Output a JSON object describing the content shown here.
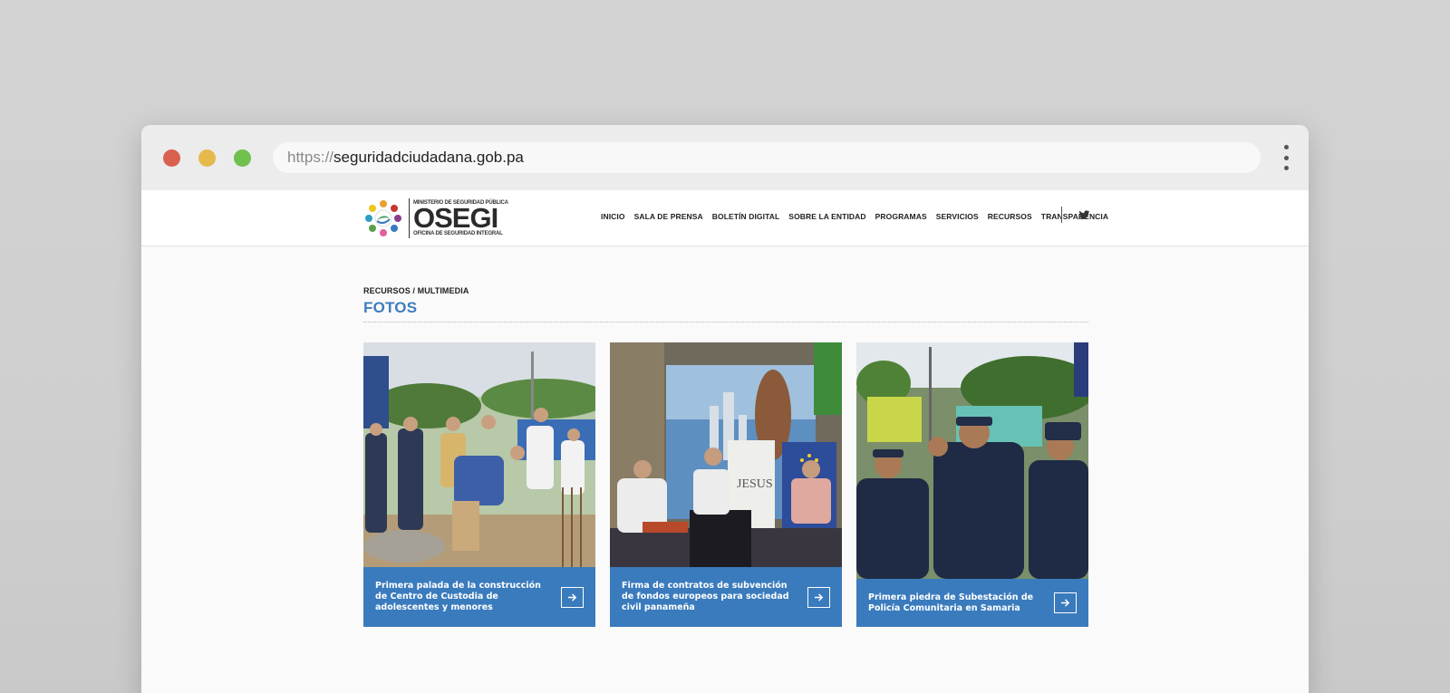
{
  "browser": {
    "url_protocol": "https://",
    "url_host": "seguridadciudadana.gob.pa"
  },
  "header": {
    "logo_top": "MINISTERIO DE SEGURIDAD PÚBLICA",
    "logo_main": "OSEGI",
    "logo_bottom": "OFICINA DE SEGURIDAD INTEGRAL",
    "nav": [
      "INICIO",
      "SALA DE PRENSA",
      "BOLETÍN DIGITAL",
      "SOBRE LA ENTIDAD",
      "PROGRAMAS",
      "SERVICIOS",
      "RECURSOS",
      "TRANSPARENCIA"
    ],
    "social_icon": "twitter-icon"
  },
  "page": {
    "breadcrumb": "RECURSOS / MULTIMEDIA",
    "title": "FOTOS"
  },
  "cards": [
    {
      "caption": "Primera palada de la construcción de Centro de Custodia de adolescentes y menores",
      "icon": "arrow-right-icon"
    },
    {
      "caption": "Firma de contratos de subvención de fondos europeos para sociedad civil panameña",
      "icon": "arrow-right-icon"
    },
    {
      "caption": "Primera piedra de Subestación de Policía Comunitaria en Samaria",
      "icon": "arrow-right-icon"
    }
  ],
  "colors": {
    "accent": "#3a7bbd",
    "title_blue": "#3d7cc0",
    "dot_red": "#d9604f",
    "dot_yellow": "#e6b94c",
    "dot_green": "#6fc04c"
  }
}
